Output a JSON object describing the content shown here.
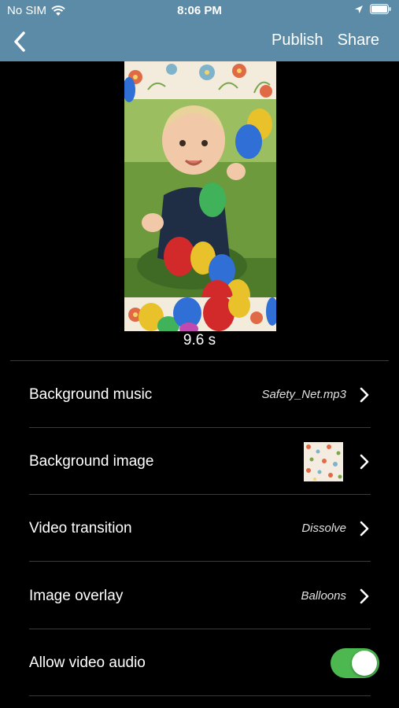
{
  "status": {
    "carrier": "No SIM",
    "time": "8:06 PM",
    "icons": [
      "wifi-icon",
      "location-arrow-icon",
      "battery-icon"
    ]
  },
  "nav": {
    "back_icon": "chevron-left-icon",
    "publish_label": "Publish",
    "share_label": "Share",
    "bar_color": "#5b8ba6"
  },
  "preview": {
    "duration": "9.6 s"
  },
  "settings": {
    "background_music": {
      "label": "Background music",
      "value": "Safety_Net.mp3"
    },
    "background_image": {
      "label": "Background image"
    },
    "video_transition": {
      "label": "Video transition",
      "value": "Dissolve"
    },
    "image_overlay": {
      "label": "Image overlay",
      "value": "Balloons"
    },
    "allow_video_audio": {
      "label": "Allow video audio",
      "enabled": true,
      "toggle_color": "#4cb84f"
    }
  }
}
